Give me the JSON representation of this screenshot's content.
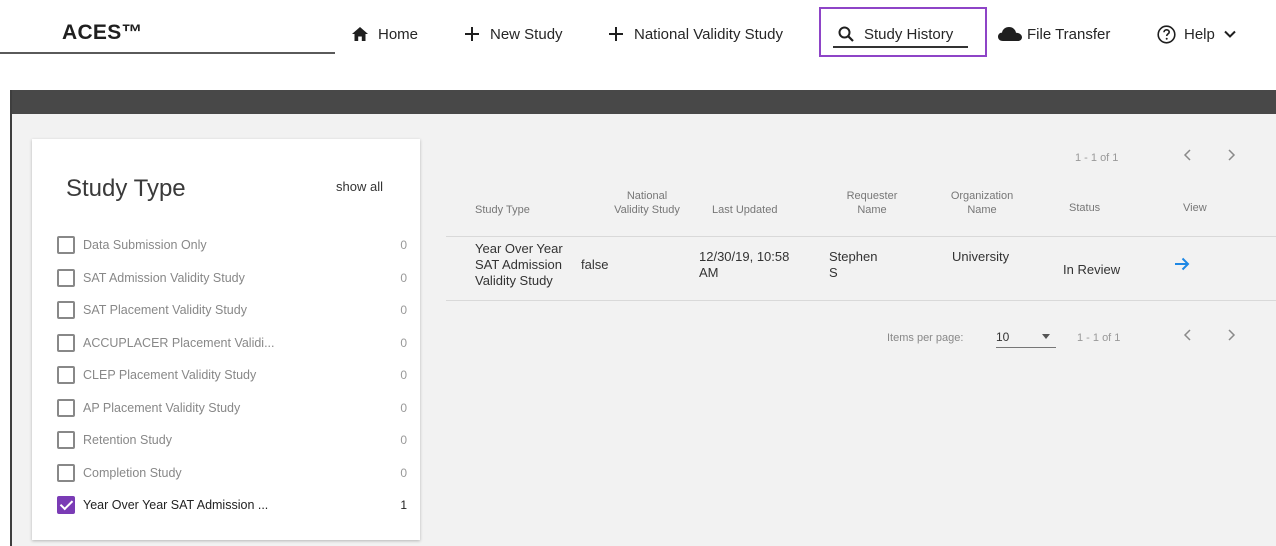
{
  "app": {
    "brand": "ACES™"
  },
  "nav": {
    "home": "Home",
    "new_study": "New Study",
    "national_validity_study": "National Validity Study",
    "study_history": "Study History",
    "file_transfer": "File Transfer",
    "help": "Help",
    "icons": {
      "home": "home-icon",
      "new_study": "plus-icon",
      "national_validity_study": "plus-icon",
      "study_history": "search-icon",
      "file_transfer": "cloud-icon",
      "help": "help-circle-icon",
      "help_dropdown": "chevron-down-icon"
    },
    "active_item": "study_history",
    "active_highlight_color": "#8e44c7"
  },
  "filters": {
    "title": "Study Type",
    "show_all": "show all",
    "items": [
      {
        "label": "Data Submission Only",
        "count": "0",
        "checked": false
      },
      {
        "label": "SAT Admission Validity Study",
        "count": "0",
        "checked": false
      },
      {
        "label": "SAT Placement Validity Study",
        "count": "0",
        "checked": false
      },
      {
        "label": "ACCUPLACER Placement Validi...",
        "count": "0",
        "checked": false
      },
      {
        "label": "CLEP Placement Validity Study",
        "count": "0",
        "checked": false
      },
      {
        "label": "AP Placement Validity Study",
        "count": "0",
        "checked": false
      },
      {
        "label": "Retention Study",
        "count": "0",
        "checked": false
      },
      {
        "label": "Completion Study",
        "count": "0",
        "checked": false
      },
      {
        "label": "Year Over Year SAT Admission ...",
        "count": "1",
        "checked": true
      }
    ],
    "checked_color": "#7a3bb5"
  },
  "table": {
    "range_top": "1 - 1 of 1",
    "headers": {
      "study_type": "Study Type",
      "national_validity_1": "National",
      "national_validity_2": "Validity Study",
      "last_updated": "Last Updated",
      "requester_1": "Requester",
      "requester_2": "Name",
      "org_1": "Organization",
      "org_2": "Name",
      "status": "Status",
      "view": "View"
    },
    "rows": [
      {
        "study_type_1": "Year Over Year",
        "study_type_2": "SAT Admission",
        "study_type_3": "Validity Study",
        "national_validity": "false",
        "last_updated_1": "12/30/19, 10:58",
        "last_updated_2": "AM",
        "requester_1": "Stephen",
        "requester_2": "S",
        "organization": "University",
        "status": "In Review",
        "view_icon": "arrow-right-icon",
        "view_icon_color": "#1e88e5"
      }
    ],
    "items_per_page_label": "Items per page:",
    "items_per_page_value": "10",
    "range_bottom": "1 - 1 of 1",
    "prev_icon": "chevron-left-icon",
    "next_icon": "chevron-right-icon"
  }
}
